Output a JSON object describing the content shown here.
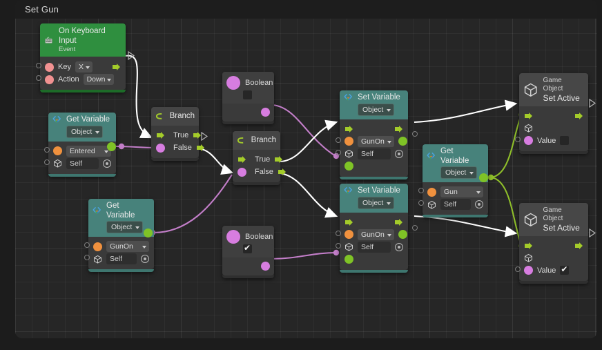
{
  "window": {
    "title": "Set Gun"
  },
  "canvas": {
    "bg": "#262626",
    "wire_exec_color": "#ffffff",
    "wire_bool_color": "#c37ec9",
    "wire_object_color": "#8fbf2a"
  },
  "nodes": {
    "on_keyboard_input": {
      "title": "On Keyboard Input",
      "subtitle": "Event",
      "icon": "keyboard-icon",
      "header_color": "#2f8f3f",
      "rows": [
        {
          "label": "Key",
          "value": "X"
        },
        {
          "label": "Action",
          "value": "Down"
        }
      ]
    },
    "get_variable_entered": {
      "title": "Get Variable",
      "type_label": "Object",
      "icon": "code-brackets-icon",
      "variable": "Entered",
      "target": "Self"
    },
    "get_variable_gunon": {
      "title": "Get Variable",
      "type_label": "Object",
      "icon": "code-brackets-icon",
      "variable": "GunOn",
      "target": "Self"
    },
    "get_variable_gun": {
      "title": "Get Variable",
      "type_label": "Object",
      "icon": "code-brackets-icon",
      "variable": "Gun",
      "target": "Self"
    },
    "branch_1": {
      "title": "Branch",
      "icon": "branch-arrow-icon",
      "true_label": "True",
      "false_label": "False"
    },
    "branch_2": {
      "title": "Branch",
      "icon": "branch-arrow-icon",
      "true_label": "True",
      "false_label": "False"
    },
    "boolean_false": {
      "title": "Boolean",
      "checked": false
    },
    "boolean_true": {
      "title": "Boolean",
      "checked": true
    },
    "set_variable_top": {
      "title": "Set Variable",
      "type_label": "Object",
      "icon": "code-brackets-icon",
      "variable": "GunOn",
      "target": "Self"
    },
    "set_variable_bottom": {
      "title": "Set Variable",
      "type_label": "Object",
      "icon": "code-brackets-icon",
      "variable": "GunOn",
      "target": "Self"
    },
    "set_active_top": {
      "title": "Game Object",
      "subtitle": "Set Active",
      "icon": "cube-icon",
      "value_label": "Value",
      "value_checked": false
    },
    "set_active_bottom": {
      "title": "Game Object",
      "subtitle": "Set Active",
      "icon": "cube-icon",
      "value_label": "Value",
      "value_checked": true
    }
  }
}
